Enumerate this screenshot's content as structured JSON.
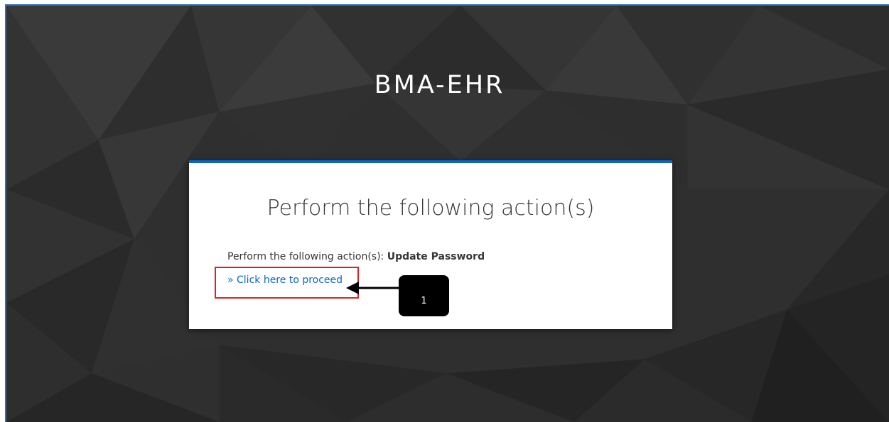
{
  "realm": {
    "title": "BMA-EHR"
  },
  "card": {
    "heading": "Perform the following action(s)",
    "instruction_prefix": "Perform the following action(s): ",
    "instruction_action": "Update Password",
    "proceed_link": "» Click here to proceed"
  },
  "annotation": {
    "callout_number": "1",
    "highlight_color": "#e0221e",
    "callout_color": "#000000"
  },
  "colors": {
    "accent": "#0a66c2",
    "background": "#2f2f2f",
    "frame_border": "#2d6fb2"
  }
}
